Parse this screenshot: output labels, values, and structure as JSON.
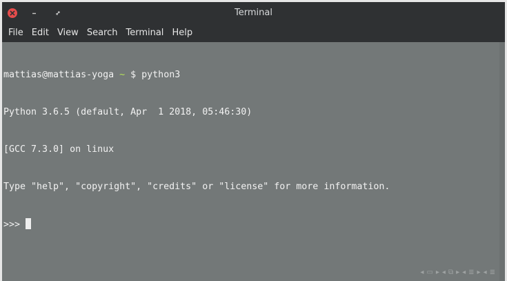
{
  "window": {
    "title": "Terminal"
  },
  "menu": {
    "items": [
      "File",
      "Edit",
      "View",
      "Search",
      "Terminal",
      "Help"
    ]
  },
  "terminal": {
    "prompt_user": "mattias@mattias-yoga",
    "prompt_tilde": "~",
    "prompt_command": "$ python3",
    "output_lines": [
      "Python 3.6.5 (default, Apr  1 2018, 05:46:30)",
      "[GCC 7.3.0] on linux",
      "Type \"help\", \"copyright\", \"credits\" or \"license\" for more information."
    ],
    "repl_prompt": ">>>"
  },
  "icons": {
    "close": "close-icon",
    "minimize": "minimize-icon",
    "maximize": "maximize-icon"
  },
  "colors": {
    "terminal_bg": "#737878",
    "titlebar_bg": "#2f3133",
    "close_red": "#e64c4c",
    "tilde_green": "#b6e35a"
  }
}
